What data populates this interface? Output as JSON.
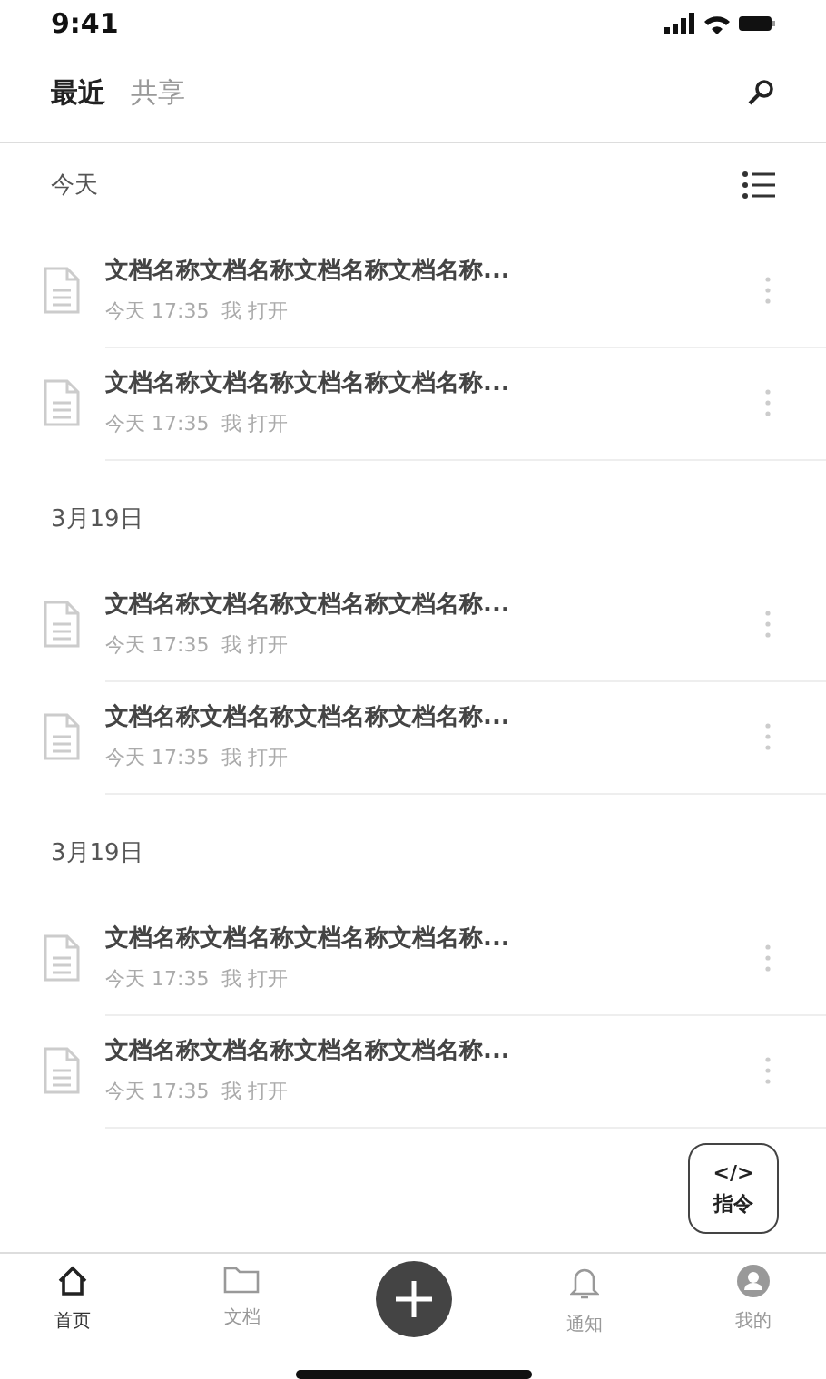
{
  "status_bar": {
    "time": "9:41"
  },
  "tabs": [
    {
      "label": "最近",
      "selected": true
    },
    {
      "label": "共享",
      "selected": false
    }
  ],
  "sections": [
    {
      "title": "今天",
      "show_view_toggle": true,
      "docs": [
        {
          "name": "文档名称文档名称文档名称文档名称...",
          "meta": "今天 17:35  我 打开"
        },
        {
          "name": "文档名称文档名称文档名称文档名称...",
          "meta": "今天 17:35  我 打开"
        }
      ]
    },
    {
      "title": "3月19日",
      "show_view_toggle": false,
      "docs": [
        {
          "name": "文档名称文档名称文档名称文档名称...",
          "meta": "今天 17:35  我 打开"
        },
        {
          "name": "文档名称文档名称文档名称文档名称...",
          "meta": "今天 17:35  我 打开"
        }
      ]
    },
    {
      "title": "3月19日",
      "show_view_toggle": false,
      "docs": [
        {
          "name": "文档名称文档名称文档名称文档名称...",
          "meta": "今天 17:35  我 打开"
        },
        {
          "name": "文档名称文档名称文档名称文档名称...",
          "meta": "今天 17:35  我 打开"
        }
      ]
    }
  ],
  "command_button": {
    "symbol": "</>",
    "label": "指令"
  },
  "nav": [
    {
      "kind": "home",
      "label": "首页",
      "selected": true
    },
    {
      "kind": "docs",
      "label": "文档",
      "selected": false
    },
    {
      "kind": "add"
    },
    {
      "kind": "bell",
      "label": "通知",
      "selected": false
    },
    {
      "kind": "user",
      "label": "我的",
      "selected": false
    }
  ]
}
